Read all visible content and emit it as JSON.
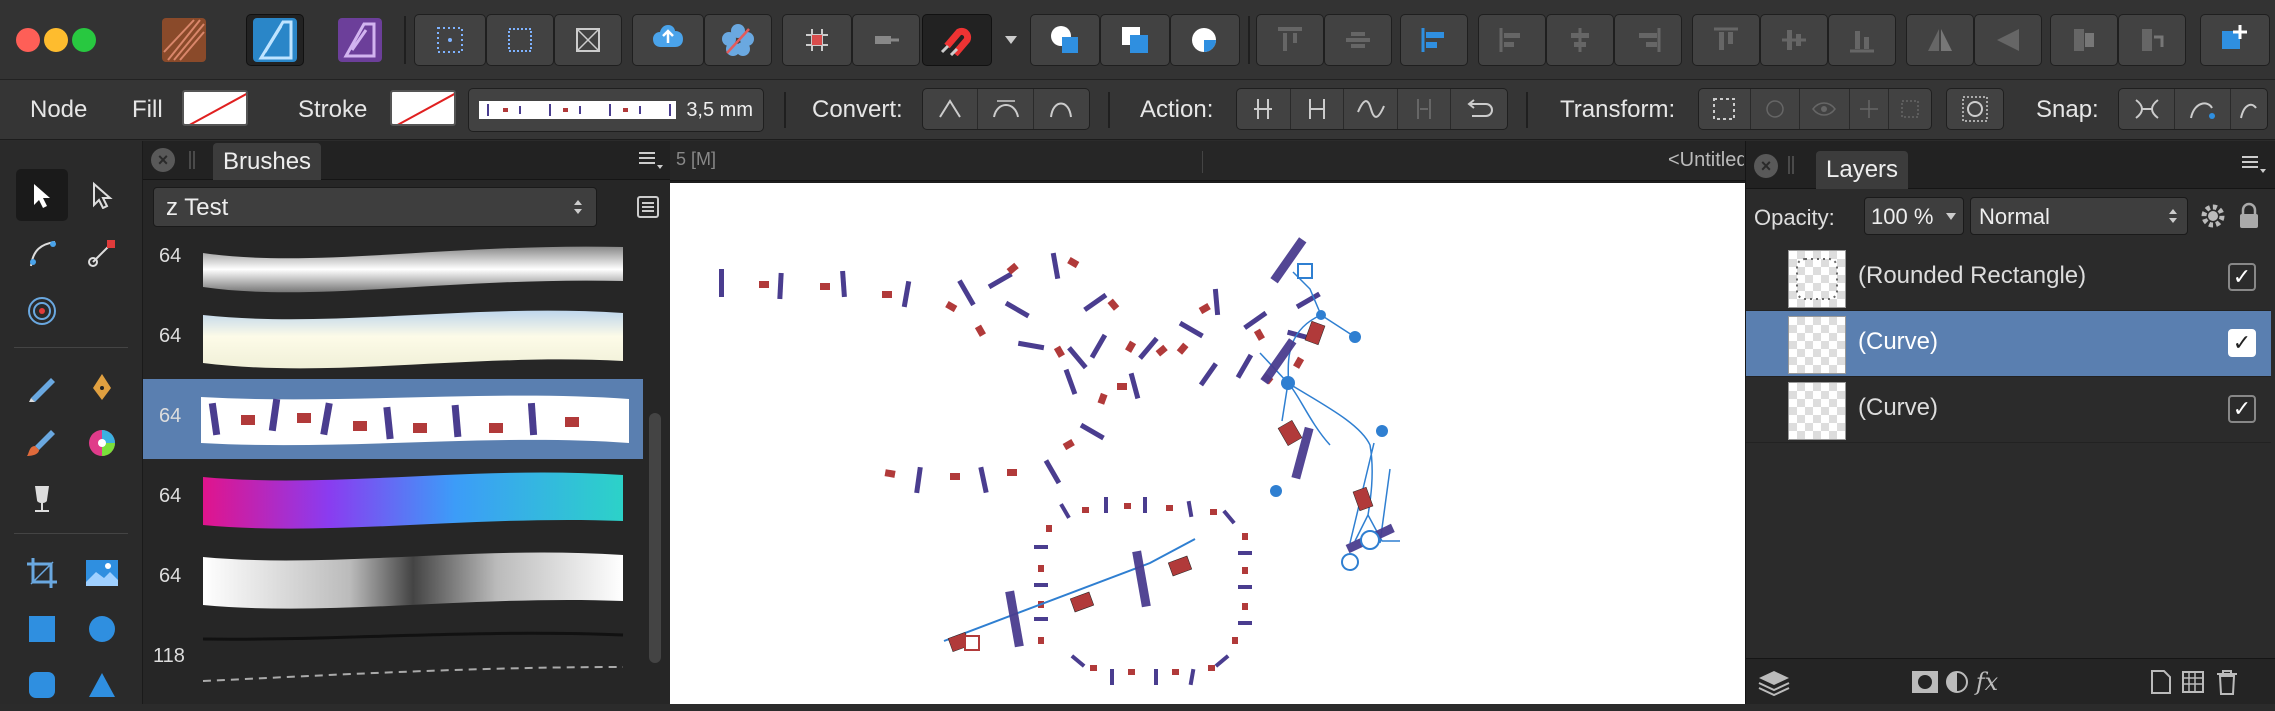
{
  "context_toolbar": {
    "mode_label": "Node",
    "fill_label": "Fill",
    "stroke_label": "Stroke",
    "stroke_width": "3,5 mm",
    "convert_label": "Convert:",
    "action_label": "Action:",
    "transform_label": "Transform:",
    "snap_label": "Snap:"
  },
  "brushes_panel": {
    "tab_label": "Brushes",
    "category": "z Test",
    "brush_sizes": [
      "64",
      "64",
      "64",
      "64",
      "64",
      "118"
    ],
    "selected_index": 2
  },
  "document": {
    "tab_info": "5  [M]",
    "tab_title": "<Untitled"
  },
  "layers_panel": {
    "tab_label": "Layers",
    "opacity_label": "Opacity:",
    "opacity_value": "100 %",
    "blend_mode": "Normal",
    "layers": [
      {
        "name": "(Rounded Rectangle)",
        "visible": true,
        "selected": false
      },
      {
        "name": "(Curve)",
        "visible": true,
        "selected": true
      },
      {
        "name": "(Curve)",
        "visible": true,
        "selected": false
      }
    ],
    "fx_label": "fx"
  },
  "colors": {
    "selection": "#5a7fb0",
    "node_blue": "#2f7fd1",
    "brush_bar": "#4a3d8f",
    "brush_square": "#b13a3a",
    "snapping_red": "#d62828"
  }
}
